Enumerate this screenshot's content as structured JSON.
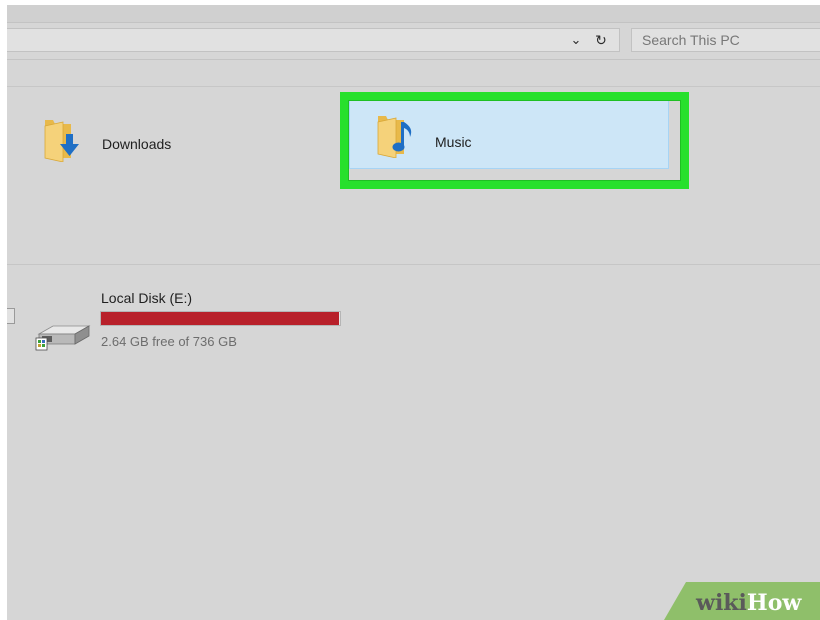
{
  "address_bar": {
    "dropdown_glyph": "⌄",
    "dropdown_icon": "chevron-down-icon",
    "refresh_glyph": "↻",
    "refresh_icon": "refresh-icon"
  },
  "search": {
    "placeholder": "Search This PC"
  },
  "folders": [
    {
      "label": "Downloads",
      "icon": "downloads-folder-icon",
      "selected": false
    },
    {
      "label": "Music",
      "icon": "music-folder-icon",
      "selected": true
    }
  ],
  "highlight": {
    "target": "Music",
    "color": "#27e02c"
  },
  "drives": [
    {
      "name": "Local Disk (E:)",
      "free_text": "2.64 GB free of 736 GB",
      "used_percent": 99.6,
      "bar_color": "#b8202a",
      "icon": "hard-drive-icon"
    }
  ],
  "watermark": {
    "part1": "wiki",
    "part2": "How"
  },
  "colors": {
    "window_bg": "#d6d6d6",
    "selection_fill": "#cde6f7",
    "usage_red": "#b8202a",
    "watermark_green": "#8fbf6a"
  }
}
